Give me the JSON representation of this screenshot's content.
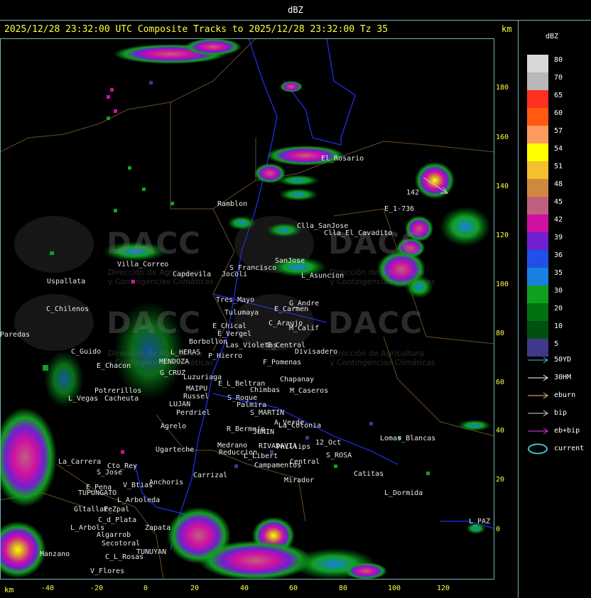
{
  "window": {
    "title": "dBZ"
  },
  "header": {
    "title": "2025/12/28 23:32:00 UTC Composite Tracks to 2025/12/28 23:32:00 Tz 35",
    "km_top": "km",
    "km_bottom": "km"
  },
  "axes": {
    "x_ticks": [
      "-40",
      "-20",
      "0",
      "20",
      "40",
      "60",
      "80",
      "100",
      "120"
    ],
    "y_ticks": [
      "180",
      "160",
      "140",
      "120",
      "100",
      "80",
      "60",
      "40",
      "20",
      "0"
    ]
  },
  "watermark": {
    "text": "DACC",
    "subtitle_line1": "Dirección de Agricultura",
    "subtitle_line2": "y Contingencias Climáticas"
  },
  "legend": {
    "title": "dBZ",
    "levels": [
      {
        "value": "80",
        "color": "#d8d8d8"
      },
      {
        "value": "70",
        "color": "#b8b8b8"
      },
      {
        "value": "65",
        "color": "#ff3020"
      },
      {
        "value": "60",
        "color": "#ff5a10"
      },
      {
        "value": "57",
        "color": "#ff9a60"
      },
      {
        "value": "54",
        "color": "#ffff00"
      },
      {
        "value": "51",
        "color": "#f4c030"
      },
      {
        "value": "48",
        "color": "#d08840"
      },
      {
        "value": "45",
        "color": "#c06080"
      },
      {
        "value": "42",
        "color": "#d010a0"
      },
      {
        "value": "39",
        "color": "#7020d0"
      },
      {
        "value": "36",
        "color": "#2050e8"
      },
      {
        "value": "35",
        "color": "#1880e0"
      },
      {
        "value": "30",
        "color": "#10a020"
      },
      {
        "value": "20",
        "color": "#007010"
      },
      {
        "value": "10",
        "color": "#005010"
      },
      {
        "value": "5",
        "color": "#403888"
      }
    ],
    "tracks": [
      {
        "label": "50YD",
        "color": "#40c0d0",
        "kind": "arrow"
      },
      {
        "label": "30HM",
        "color": "#ffffff",
        "kind": "arrow"
      },
      {
        "label": "eburn",
        "color": "#f0c080",
        "kind": "arrow"
      },
      {
        "label": "bip",
        "color": "#f0c8d0",
        "kind": "arrow"
      },
      {
        "label": "eb+bip",
        "color": "#e040e0",
        "kind": "arrow"
      },
      {
        "label": "current",
        "color": "#40c0d0",
        "kind": "ellipse"
      }
    ]
  },
  "places": [
    {
      "name": "El_Rosario"
    },
    {
      "name": "Ramblon"
    },
    {
      "name": "E_1-736"
    },
    {
      "name": "Clla_SanJose"
    },
    {
      "name": "Clla_El_Cavadito"
    },
    {
      "name": "Villa_Correo"
    },
    {
      "name": "Capdevila"
    },
    {
      "name": "S_Francisco"
    },
    {
      "name": "SanJose"
    },
    {
      "name": "L_Asuncion"
    },
    {
      "name": "Uspallata"
    },
    {
      "name": "Jocoli"
    },
    {
      "name": "Tres_Mayo"
    },
    {
      "name": "Tulumaya"
    },
    {
      "name": "G_Andre"
    },
    {
      "name": "E_Carmen"
    },
    {
      "name": "C_Chilenos"
    },
    {
      "name": "E_Chical"
    },
    {
      "name": "C_Araujo"
    },
    {
      "name": "M_Calif"
    },
    {
      "name": "E_Vergel"
    },
    {
      "name": "Borbollon"
    },
    {
      "name": "Las_Violetas"
    },
    {
      "name": "E_Central"
    },
    {
      "name": "Divisadero"
    },
    {
      "name": "C_Guido"
    },
    {
      "name": "P_Hierro"
    },
    {
      "name": "L_HERAS"
    },
    {
      "name": "E_Chacon"
    },
    {
      "name": "MENDOZA"
    },
    {
      "name": "F_Pomenas"
    },
    {
      "name": "G_CRUZ"
    },
    {
      "name": "Luzuriaga"
    },
    {
      "name": "E_L_Beltran"
    },
    {
      "name": "Chapanay"
    },
    {
      "name": "Potrerillos"
    },
    {
      "name": "L_Vegas"
    },
    {
      "name": "Cacheuta"
    },
    {
      "name": "MAIPU"
    },
    {
      "name": "Russel"
    },
    {
      "name": "LUJAN"
    },
    {
      "name": "S_Roque"
    },
    {
      "name": "Chimbas"
    },
    {
      "name": "M_Caseros"
    },
    {
      "name": "Palmira"
    },
    {
      "name": "Perdriel"
    },
    {
      "name": "S_MARTIN"
    },
    {
      "name": "A_Verde"
    },
    {
      "name": "Agrelo"
    },
    {
      "name": "R_Bermejo"
    },
    {
      "name": "JUNIN"
    },
    {
      "name": "La_Colonia"
    },
    {
      "name": "Ugarteche"
    },
    {
      "name": "Medrano"
    },
    {
      "name": "RIVADAVIA"
    },
    {
      "name": "Phillips"
    },
    {
      "name": "12_Oct"
    },
    {
      "name": "Lomas_Blancas"
    },
    {
      "name": "Reduccion"
    },
    {
      "name": "S_ROSA"
    },
    {
      "name": "La_Carrera"
    },
    {
      "name": "Cto_Rey"
    },
    {
      "name": "L_Libert"
    },
    {
      "name": "S_Jose"
    },
    {
      "name": "Carrizal"
    },
    {
      "name": "Campamentos"
    },
    {
      "name": "Central"
    },
    {
      "name": "Catitas"
    },
    {
      "name": "E_Pena"
    },
    {
      "name": "V_Btias"
    },
    {
      "name": "Anchoris"
    },
    {
      "name": "Mirador"
    },
    {
      "name": "TUPUNGATO"
    },
    {
      "name": "L_Arboleda"
    },
    {
      "name": "L_Dormida"
    },
    {
      "name": "Gltallare"
    },
    {
      "name": "E_Zpal"
    },
    {
      "name": "C_d_Plata"
    },
    {
      "name": "L_PAZ"
    },
    {
      "name": "L_Arbols"
    },
    {
      "name": "Zapata"
    },
    {
      "name": "Algarrob"
    },
    {
      "name": "Secotoral"
    },
    {
      "name": "Manzano"
    },
    {
      "name": "TUNUYAN"
    },
    {
      "name": "C_L_Rosas"
    },
    {
      "name": "V_Flores"
    },
    {
      "name": "Paredas"
    },
    {
      "name": "142"
    }
  ]
}
